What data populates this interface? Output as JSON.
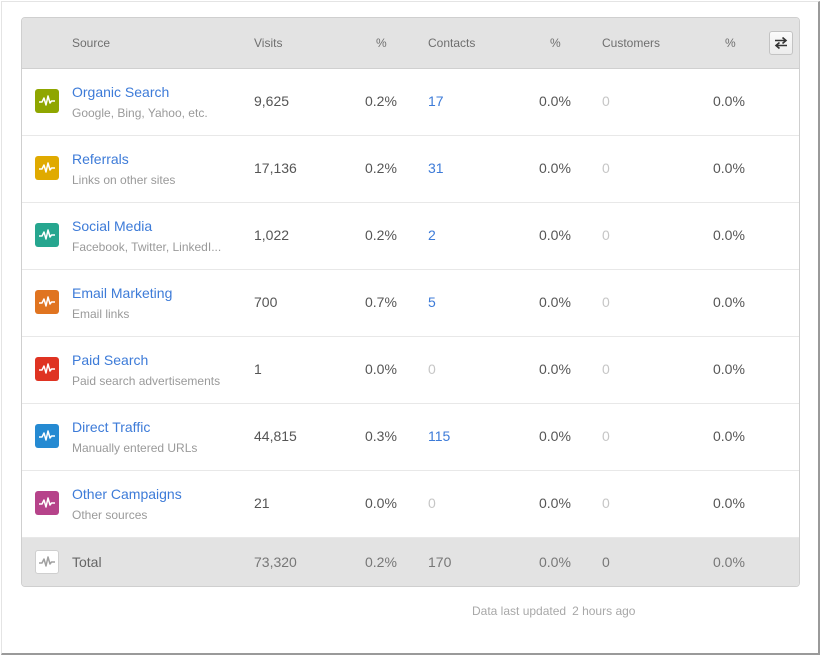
{
  "table": {
    "headers": {
      "source": "Source",
      "visits": "Visits",
      "visits_pct": "%",
      "contacts": "Contacts",
      "contacts_pct": "%",
      "customers": "Customers",
      "customers_pct": "%"
    },
    "swap_button_icon": "swap-arrows-icon",
    "rows": [
      {
        "name": "Organic Search",
        "desc": "Google, Bing, Yahoo, etc.",
        "color": "#8fa600",
        "icon": "pulse-icon",
        "visits": "9,625",
        "visits_pct": "0.2%",
        "contacts": "17",
        "contacts_pct": "0.0%",
        "customers": "0",
        "customers_pct": "0.0%"
      },
      {
        "name": "Referrals",
        "desc": "Links on other sites",
        "color": "#e0aa00",
        "icon": "pulse-icon",
        "visits": "17,136",
        "visits_pct": "0.2%",
        "contacts": "31",
        "contacts_pct": "0.0%",
        "customers": "0",
        "customers_pct": "0.0%"
      },
      {
        "name": "Social Media",
        "desc": "Facebook, Twitter, LinkedI...",
        "color": "#26a68f",
        "icon": "pulse-icon",
        "visits": "1,022",
        "visits_pct": "0.2%",
        "contacts": "2",
        "contacts_pct": "0.0%",
        "customers": "0",
        "customers_pct": "0.0%"
      },
      {
        "name": "Email Marketing",
        "desc": "Email links",
        "color": "#e07420",
        "icon": "pulse-icon",
        "visits": "700",
        "visits_pct": "0.7%",
        "contacts": "5",
        "contacts_pct": "0.0%",
        "customers": "0",
        "customers_pct": "0.0%"
      },
      {
        "name": "Paid Search",
        "desc": "Paid search advertisements",
        "color": "#df3322",
        "icon": "pulse-icon",
        "visits": "1",
        "visits_pct": "0.0%",
        "contacts": "0",
        "contacts_pct": "0.0%",
        "customers": "0",
        "customers_pct": "0.0%"
      },
      {
        "name": "Direct Traffic",
        "desc": "Manually entered URLs",
        "color": "#258ad2",
        "icon": "pulse-icon",
        "visits": "44,815",
        "visits_pct": "0.3%",
        "contacts": "115",
        "contacts_pct": "0.0%",
        "customers": "0",
        "customers_pct": "0.0%"
      },
      {
        "name": "Other Campaigns",
        "desc": "Other sources",
        "color": "#b6438a",
        "icon": "pulse-icon",
        "visits": "21",
        "visits_pct": "0.0%",
        "contacts": "0",
        "contacts_pct": "0.0%",
        "customers": "0",
        "customers_pct": "0.0%"
      }
    ],
    "total": {
      "label": "Total",
      "icon": "pulse-icon",
      "visits": "73,320",
      "visits_pct": "0.2%",
      "contacts": "170",
      "contacts_pct": "0.0%",
      "customers": "0",
      "customers_pct": "0.0%"
    }
  },
  "footer": {
    "updated_label": "Data last updated",
    "updated_value": "2 hours ago"
  },
  "colors": {
    "link": "#3d7bd8",
    "header_bg": "#e3e3e3",
    "muted_zero": "#c6c6c6"
  }
}
